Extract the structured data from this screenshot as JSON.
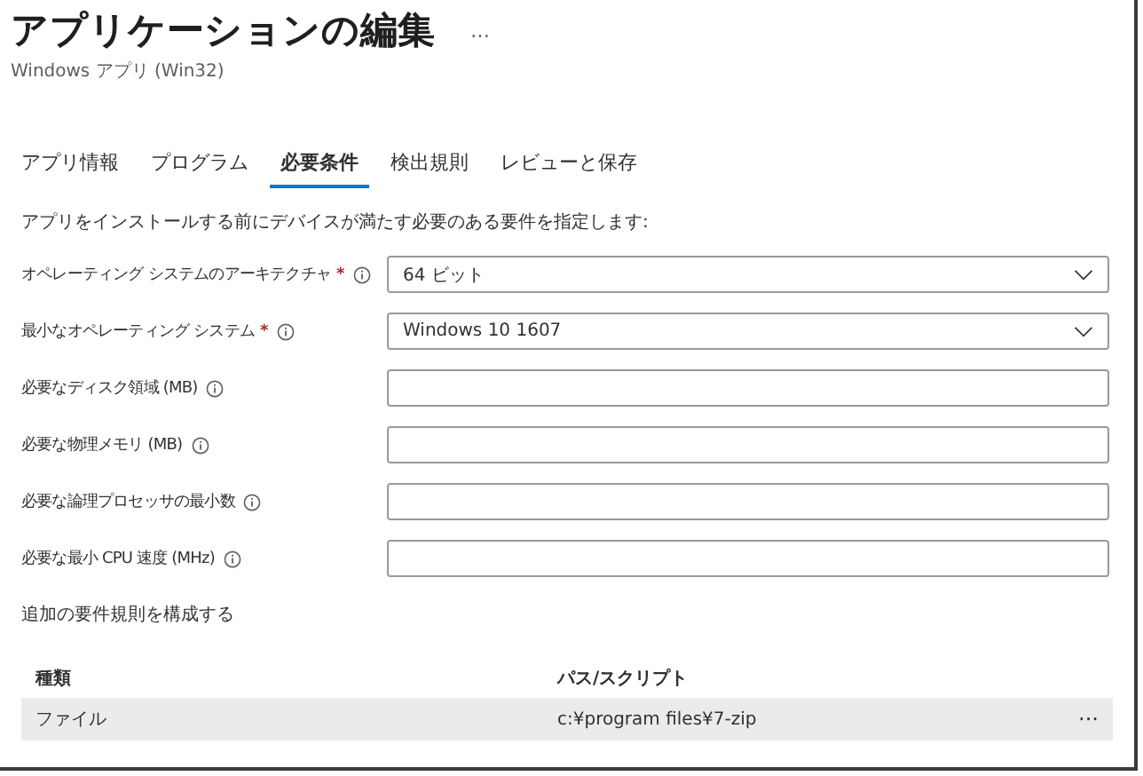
{
  "header": {
    "title": "アプリケーションの編集",
    "more": "…",
    "subtitle": "Windows アプリ (Win32)"
  },
  "tabs": [
    {
      "label": "アプリ情報",
      "selected": false
    },
    {
      "label": "プログラム",
      "selected": false
    },
    {
      "label": "必要条件",
      "selected": true
    },
    {
      "label": "検出規則",
      "selected": false
    },
    {
      "label": "レビューと保存",
      "selected": false
    }
  ],
  "description": "アプリをインストールする前にデバイスが満たす必要のある要件を指定します:",
  "fields": [
    {
      "label": "オペレーティング システムのアーキテクチャ",
      "required_mark": "*",
      "kind": "select",
      "value": "64 ビット"
    },
    {
      "label": "最小なオペレーティング システム",
      "required_mark": "*",
      "kind": "select",
      "value": "Windows 10 1607"
    },
    {
      "label": "必要なディスク領域 (MB)",
      "kind": "text"
    },
    {
      "label": "必要な物理メモリ (MB)",
      "kind": "text"
    },
    {
      "label": "必要な論理プロセッサの最小数",
      "kind": "text"
    },
    {
      "label": "必要な最小 CPU 速度 (MHz)",
      "kind": "text"
    }
  ],
  "rules_heading": "追加の要件規則を構成する",
  "table": {
    "columns": [
      "種類",
      "パス/スクリプト"
    ],
    "rows": [
      {
        "cells": [
          "ファイル",
          "c:¥program files¥7-zip"
        ],
        "more": "···"
      }
    ]
  }
}
